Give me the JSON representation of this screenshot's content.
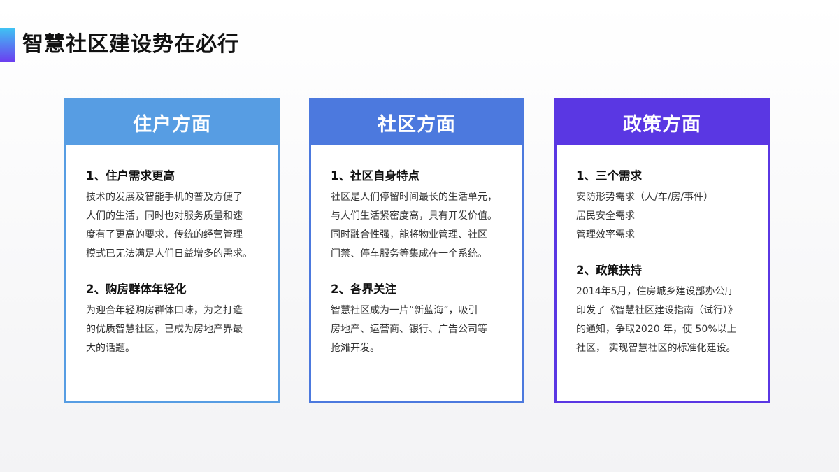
{
  "page_title": "智慧社区建设势在必行",
  "colors": {
    "accent_gradient": [
      "#3fc3f3",
      "#6b3ff0"
    ],
    "card_residents": "#579de3",
    "card_community": "#4c79de",
    "card_policy": "#5a37e3"
  },
  "cards": [
    {
      "title": "住户方面",
      "sections": [
        {
          "heading": "1、住户需求更高",
          "lines": [
            "技术的发展及智能手机的普及方便了",
            "人们的生活，同时也对服务质量和速",
            "度有了更高的要求，传统的经营管理",
            "模式已无法满足人们日益增多的需求。"
          ]
        },
        {
          "heading": "2、购房群体年轻化",
          "lines": [
            "为迎合年轻购房群体口味，为之打造",
            "的优质智慧社区，已成为房地产界最",
            "大的话题。"
          ]
        }
      ]
    },
    {
      "title": "社区方面",
      "sections": [
        {
          "heading": "1、社区自身特点",
          "lines": [
            "社区是人们停留时间最长的生活单元，",
            "与人们生活紧密度高，具有开发价值。",
            "同时融合性强，能将物业管理、社区",
            "门禁、停车服务等集成在一个系统。"
          ]
        },
        {
          "heading": "2、各界关注",
          "lines": [
            "智慧社区成为一片“新蓝海”，吸引",
            "房地产、运营商、银行、广告公司等",
            "抢滩开发。"
          ]
        }
      ]
    },
    {
      "title": "政策方面",
      "sections": [
        {
          "heading": "1、三个需求",
          "lines": [
            "安防形势需求（人/车/房/事件）",
            "居民安全需求",
            "管理效率需求"
          ]
        },
        {
          "heading": "2、政策扶持",
          "lines": [
            "2014年5月，住房城乡建设部办公厅",
            "印发了《智慧社区建设指南（试行）》",
            "的通知，争取2020 年，使 50%以上",
            "社区， 实现智慧社区的标准化建设。"
          ]
        }
      ]
    }
  ]
}
